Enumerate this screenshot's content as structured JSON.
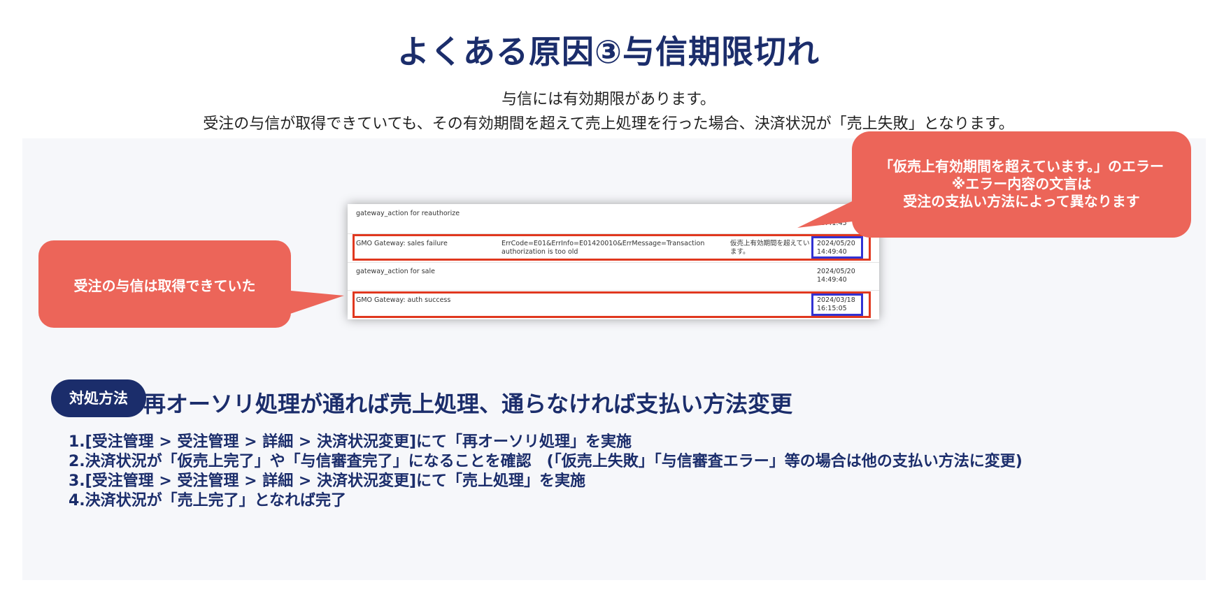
{
  "title": "よくある原因③与信期限切れ",
  "subtitle_lines": [
    "与信には有効期限があります。",
    "受注の与信が取得できていても、その有効期間を超えて売上処理を行った場合、決済状況が「売上失敗」となります。"
  ],
  "screenshot": {
    "rows": [
      {
        "action": "gateway_action for reauthorize",
        "detail": "",
        "message": "",
        "date": "",
        "time": "15:41:45"
      },
      {
        "action": "GMO Gateway: sales failure",
        "detail": "ErrCode=E01&ErrInfo=E01420010&ErrMessage=Transaction",
        "detail2": "authorization is too old",
        "message": "仮売上有効期間を超えてい",
        "message2": "ます。",
        "date": "2024/05/20",
        "time": "14:49:40"
      },
      {
        "action": "gateway_action for sale",
        "detail": "",
        "message": "",
        "date": "2024/05/20",
        "time": "14:49:40"
      },
      {
        "action": "GMO Gateway: auth success",
        "detail": "",
        "message": "",
        "date": "2024/03/18",
        "time": "16:15:05"
      }
    ]
  },
  "callout_left": "受注の与信は取得できていた",
  "callout_right": [
    "「仮売上有効期間を超えています。」のエラー",
    "※エラー内容の文言は",
    "受注の支払い方法によって異なります"
  ],
  "solution": {
    "pill_label": "対処方法",
    "heading": "再オーソリ処理が通れば売上処理、通らなければ支払い方法変更",
    "steps": [
      "1.[受注管理 > 受注管理 > 詳細 > 決済状況変更]にて「再オーソリ処理」を実施",
      "2.決済状況が「仮売上完了」や「与信審査完了」になることを確認　(「仮売上失敗」「与信審査エラー」等の場合は他の支払い方法に変更)",
      "3.[受注管理 > 受注管理 > 詳細 > 決済状況変更]にて「売上処理」を実施",
      "4.決済状況が「売上完了」となれば完了"
    ]
  },
  "colors": {
    "navy": "#1b2d6b",
    "callout": "#ec6559",
    "highlight_red": "#e0381f",
    "highlight_blue": "#3232d2",
    "panel_bg": "#f6f7fa"
  }
}
